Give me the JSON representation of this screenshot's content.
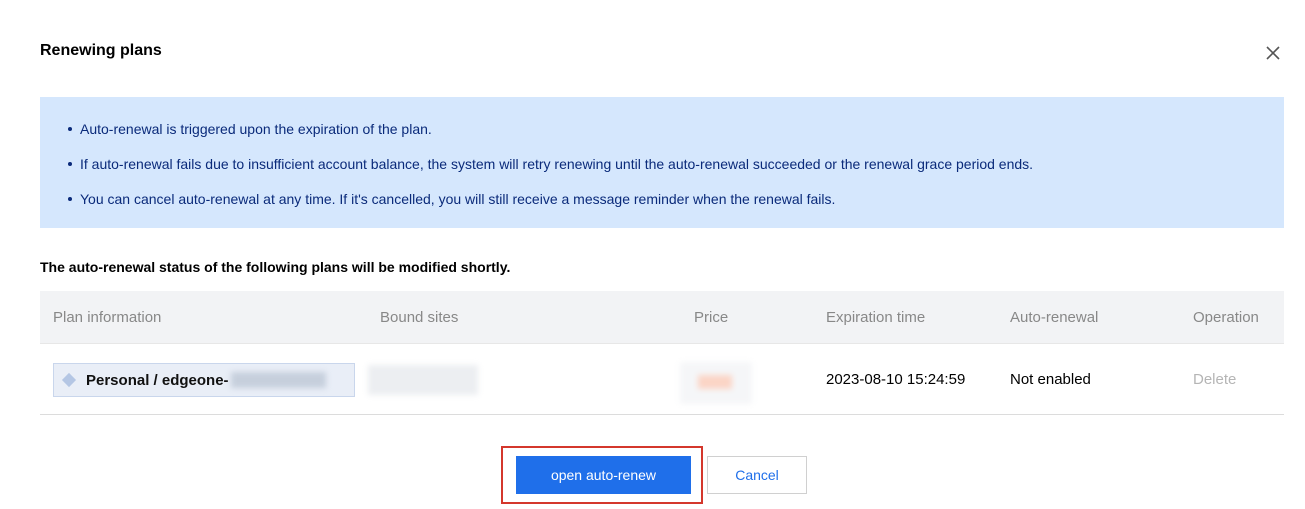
{
  "dialog": {
    "title": "Renewing plans",
    "close_icon": "close-icon"
  },
  "notice": {
    "items": [
      "Auto-renewal is triggered upon the expiration of the plan.",
      "If auto-renewal fails due to insufficient account balance, the system will retry renewing until the auto-renewal succeeded or the renewal grace period ends.",
      "You can cancel auto-renewal at any time. If it's cancelled, you will still receive a message reminder when the renewal fails."
    ],
    "background_color": "#d5e7fd",
    "text_color": "#0a2a7a"
  },
  "section": {
    "label": "The auto-renewal status of the following plans will be modified shortly."
  },
  "table": {
    "columns": {
      "plan": "Plan information",
      "sites": "Bound sites",
      "price": "Price",
      "expiration": "Expiration time",
      "auto_renewal": "Auto-renewal",
      "operation": "Operation"
    },
    "rows": [
      {
        "plan": "Personal / edgeone-",
        "plan_icon": "diamond-icon",
        "expiration": "2023-08-10 15:24:59",
        "auto_renewal": "Not enabled",
        "operation": "Delete"
      }
    ]
  },
  "footer": {
    "confirm_label": "open auto-renew",
    "cancel_label": "Cancel",
    "accent_color": "#1f6fea",
    "highlight_color": "#d4372c"
  }
}
